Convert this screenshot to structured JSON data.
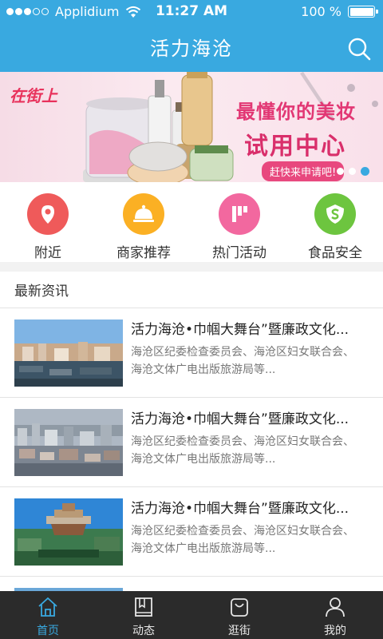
{
  "status": {
    "carrier": "Applidium",
    "time": "11:27 AM",
    "battery_text": "100 %",
    "battery_level": 1.0
  },
  "header": {
    "title": "活力海沧"
  },
  "banner": {
    "tag": "在街上",
    "headline1": "最懂你的美妆",
    "headline2": "试用中心",
    "cta": "赶快来申请吧!"
  },
  "categories": [
    {
      "label": "附近",
      "icon": "location-pin-icon",
      "color": "#ef5a5a"
    },
    {
      "label": "商家推荐",
      "icon": "service-bell-icon",
      "color": "#fbb024"
    },
    {
      "label": "热门活动",
      "icon": "flag-icon",
      "color": "#f2689f"
    },
    {
      "label": "食品安全",
      "icon": "shield-s-icon",
      "color": "#6dc53f"
    }
  ],
  "news": {
    "heading": "最新资讯",
    "items": [
      {
        "title": "活力海沧•巾帼大舞台”暨廉政文化...",
        "desc1": "海沧区纪委检查委员会、海沧区妇女联合会、",
        "desc2": "海沧文体广电出版旅游局等..."
      },
      {
        "title": "活力海沧•巾帼大舞台”暨廉政文化...",
        "desc1": "海沧区纪委检查委员会、海沧区妇女联合会、",
        "desc2": "海沧文体广电出版旅游局等..."
      },
      {
        "title": "活力海沧•巾帼大舞台”暨廉政文化...",
        "desc1": "海沧区纪委检查委员会、海沧区妇女联合会、",
        "desc2": "海沧文体广电出版旅游局等..."
      }
    ]
  },
  "tabs": [
    {
      "label": "首页",
      "icon": "home-icon"
    },
    {
      "label": "动态",
      "icon": "book-icon"
    },
    {
      "label": "逛街",
      "icon": "shopping-bag-icon"
    },
    {
      "label": "我的",
      "icon": "person-icon"
    }
  ]
}
